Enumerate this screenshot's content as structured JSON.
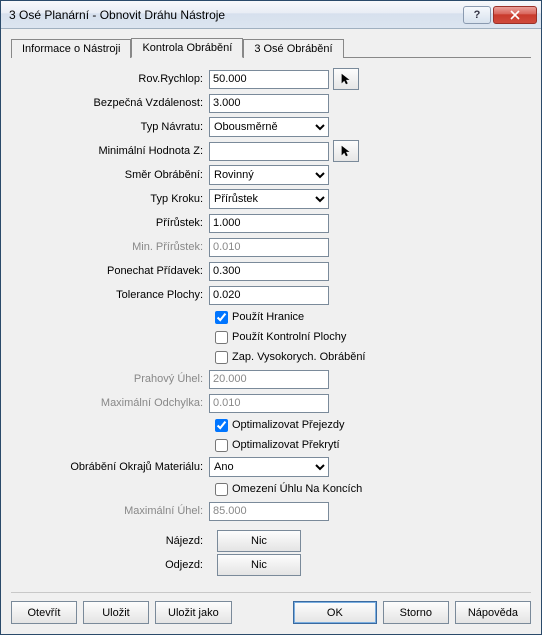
{
  "window": {
    "title": "3 Osé Planární - Obnovit Dráhu Nástroje"
  },
  "tabs": [
    {
      "label": "Informace o Nástroji"
    },
    {
      "label": "Kontrola Obrábění"
    },
    {
      "label": "3 Osé Obrábění"
    }
  ],
  "labels": {
    "rov_rychlop": "Rov.Rychlop:",
    "bezpecna": "Bezpečná Vzdálenost:",
    "typ_navratu": "Typ Návratu:",
    "min_hodnota_z": "Minimální Hodnota Z:",
    "smer": "Směr Obrábění:",
    "typ_kroku": "Typ Kroku:",
    "prirustek": "Přírůstek:",
    "min_prirustek": "Min. Přírůstek:",
    "ponechat": "Ponechat Přídavek:",
    "tolerance": "Tolerance Plochy:",
    "prahovy": "Prahový Úhel:",
    "max_odchylka": "Maximální Odchylka:",
    "okraje": "Obrábění Okrajů Materiálu:",
    "max_uhel": "Maximální Úhel:",
    "najezd": "Nájezd:",
    "odjezd": "Odjezd:"
  },
  "values": {
    "rov_rychlop": "50.000",
    "bezpecna": "3.000",
    "typ_navratu": "Obousměrně",
    "min_hodnota_z": "",
    "smer": "Rovinný",
    "typ_kroku": "Přírůstek",
    "prirustek": "1.000",
    "min_prirustek": "0.010",
    "ponechat": "0.300",
    "tolerance": "0.020",
    "prahovy": "20.000",
    "max_odchylka": "0.010",
    "okraje": "Ano",
    "max_uhel": "85.000",
    "najezd_btn": "Nic",
    "odjezd_btn": "Nic"
  },
  "checks": {
    "pouzit_hranice": "Použít Hranice",
    "pouzit_kontrolni": "Použít Kontrolní Plochy",
    "zap_vysokorych": "Zap. Vysokorych. Obrábění",
    "opt_prejezdy": "Optimalizovat Přejezdy",
    "opt_prekryti": "Optimalizovat Překrytí",
    "omezeni_uhlu": "Omezení Úhlu Na Koncích"
  },
  "buttons": {
    "otevrit": "Otevřít",
    "ulozit": "Uložit",
    "ulozit_jako": "Uložit jako",
    "ok": "OK",
    "storno": "Storno",
    "napoveda": "Nápověda"
  }
}
